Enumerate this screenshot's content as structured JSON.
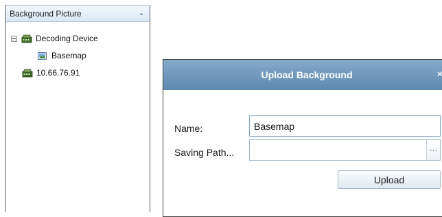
{
  "left_panel": {
    "title": "Background Picture",
    "tree": {
      "root": {
        "label": "Decoding Device",
        "expanded": true,
        "icon": "decoding-device-icon"
      },
      "child": {
        "label": "Basemap",
        "icon": "image-icon"
      },
      "device2": {
        "label": "10.66.76.91",
        "icon": "decoding-device-icon"
      }
    }
  },
  "dialog": {
    "title": "Upload Background",
    "close_glyph": "×",
    "name_label": "Name:",
    "name_value": "Basemap",
    "saving_path_label": "Saving Path...",
    "saving_path_value": "",
    "browse_label": "···",
    "upload_label": "Upload"
  },
  "colors": {
    "titlebar": "#6f97bc",
    "panel_header": "#dbe6f4",
    "input_border": "#9fb6cf"
  }
}
